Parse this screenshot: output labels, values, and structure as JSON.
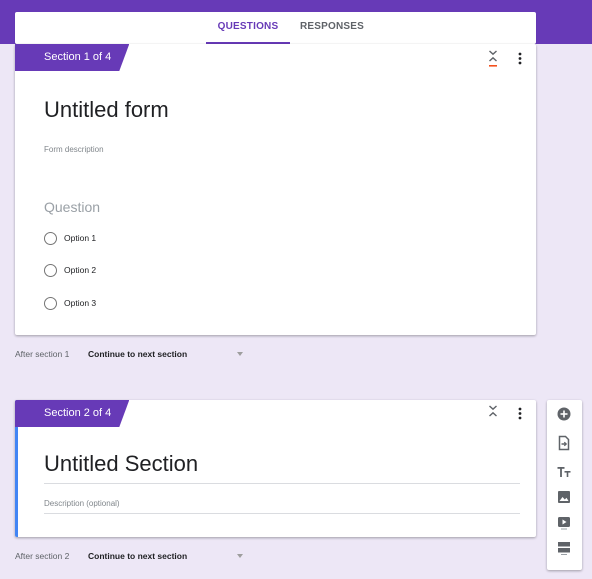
{
  "tabs": {
    "questions": "QUESTIONS",
    "responses": "RESPONSES",
    "active": "questions"
  },
  "section1": {
    "badge": "Section 1 of 4",
    "title": "Untitled form",
    "description": "Form description",
    "question": "Question",
    "options": [
      "Option 1",
      "Option 2",
      "Option 3"
    ],
    "after_label": "After section 1",
    "after_value": "Continue to next section"
  },
  "section2": {
    "badge": "Section 2 of 4",
    "title": "Untitled Section",
    "description": "Description (optional)",
    "after_label": "After section 2",
    "after_value": "Continue to next section"
  },
  "toolbar": {
    "items": [
      "add-question-icon",
      "import-questions-icon",
      "add-title-icon",
      "add-image-icon",
      "add-video-icon",
      "add-section-icon"
    ]
  },
  "colors": {
    "accent": "#673ab7",
    "background": "#ede7f6",
    "focus": "#4285f4",
    "collapse_arrow": "#f4511e"
  }
}
